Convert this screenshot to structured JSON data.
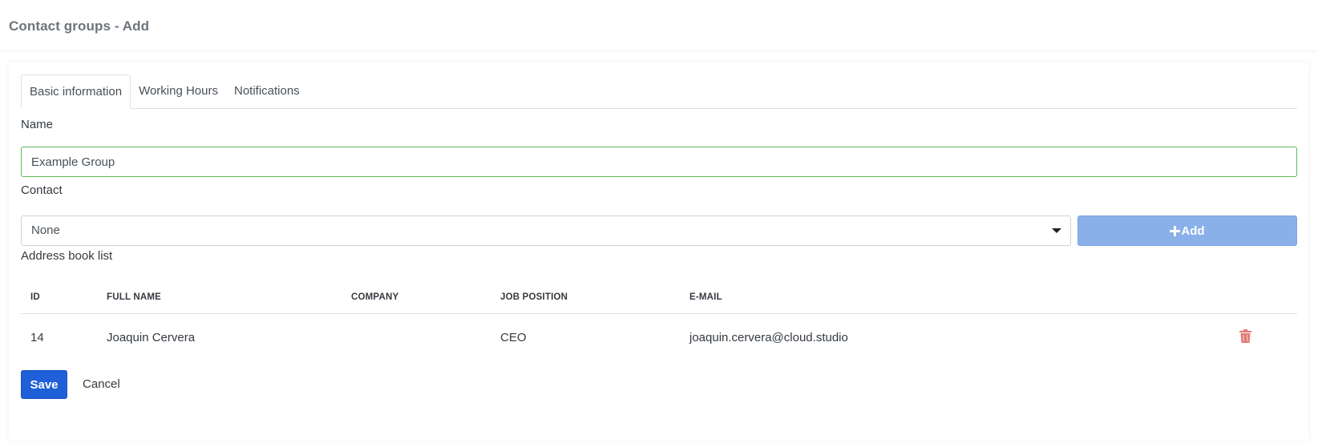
{
  "page": {
    "title": "Contact groups - Add"
  },
  "tabs": [
    {
      "label": "Basic information",
      "active": true
    },
    {
      "label": "Working Hours",
      "active": false
    },
    {
      "label": "Notifications",
      "active": false
    }
  ],
  "form": {
    "name_label": "Name",
    "name_value": "Example Group",
    "contact_label": "Contact",
    "contact_selected": "None",
    "add_button_label": "Add",
    "address_book_label": "Address book list"
  },
  "table": {
    "columns": [
      "ID",
      "FULL NAME",
      "COMPANY",
      "JOB POSITION",
      "E-MAIL"
    ],
    "rows": [
      {
        "id": "14",
        "full_name": "Joaquin Cervera",
        "company": "",
        "job_position": "CEO",
        "email": "joaquin.cervera@cloud.studio"
      }
    ]
  },
  "actions": {
    "save_label": "Save",
    "cancel_label": "Cancel"
  },
  "icons": {
    "add": "plus-icon",
    "delete": "trash-icon",
    "select": "caret-down-icon"
  },
  "colors": {
    "primary": "#1f5fd8",
    "add_button": "#8ab0ea",
    "valid_border": "#5cb85c",
    "delete_icon": "#e07a73"
  }
}
